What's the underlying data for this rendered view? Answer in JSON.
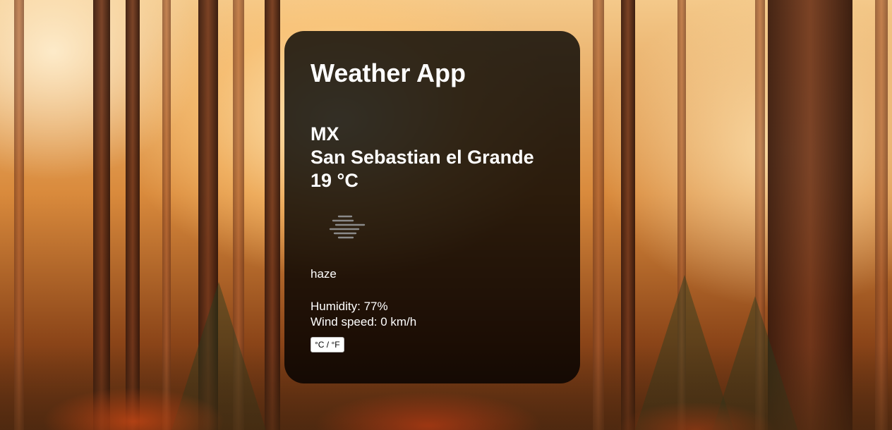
{
  "app": {
    "title": "Weather App"
  },
  "weather": {
    "country": "MX",
    "city": "San Sebastian el Grande",
    "temperature": "19 °C",
    "icon": "haze-icon",
    "description": "haze",
    "humidity": "Humidity: 77%",
    "wind_speed": "Wind speed: 0 km/h"
  },
  "controls": {
    "unit_toggle_label": "°C / °F"
  },
  "colors": {
    "card_background": "#000000cc",
    "text": "#ffffff",
    "icon": "#8a8a8a"
  }
}
